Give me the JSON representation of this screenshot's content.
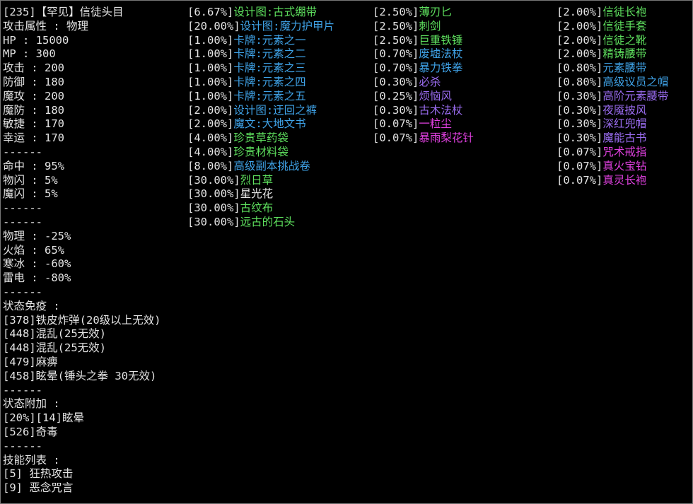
{
  "colors": {
    "white": "#e4e4e4",
    "green": "#5ee05e",
    "blue": "#3fa3e8",
    "purple": "#9a6cf0",
    "magenta": "#e040e0",
    "background": "#000000"
  },
  "monster": {
    "lines": [
      "[235]【罕见】信徒头目",
      "攻击属性 : 物理",
      "HP : 15000",
      "MP : 300",
      "攻击 : 200",
      "防御 : 180",
      "魔攻 : 200",
      "魔防 : 180",
      "敏捷 : 170",
      "幸运 : 170",
      "------",
      "命中 : 95%",
      "物闪 : 5%",
      "魔闪 : 5%",
      "------",
      "------",
      "物理 : -25%",
      "火焰 : 65%",
      "寒冰 : -60%",
      "雷电 : -80%",
      "------",
      "状态免疫 :",
      "[378]铁皮炸弹(20级以上无效)",
      "[448]混乱(25无效)",
      "[448]混乱(25无效)",
      "[479]麻痹",
      "[458]眩晕(锤头之拳 30无效)",
      "------",
      "状态附加 :",
      "[20%][14]眩晕",
      "[526]奇毒",
      "------",
      "技能列表 :",
      "[5] 狂热攻击",
      "[9] 恶念咒言"
    ]
  },
  "drops_col2": [
    {
      "pct": "[6.67%]",
      "name": "设计图:古式绷带",
      "color": "green"
    },
    {
      "pct": "[20.00%]",
      "name": "设计图:魔力护甲片",
      "color": "blue"
    },
    {
      "pct": "[1.00%]",
      "name": "卡牌:元素之一",
      "color": "blue"
    },
    {
      "pct": "[1.00%]",
      "name": "卡牌:元素之二",
      "color": "blue"
    },
    {
      "pct": "[1.00%]",
      "name": "卡牌:元素之三",
      "color": "blue"
    },
    {
      "pct": "[1.00%]",
      "name": "卡牌:元素之四",
      "color": "blue"
    },
    {
      "pct": "[1.00%]",
      "name": "卡牌:元素之五",
      "color": "blue"
    },
    {
      "pct": "[2.00%]",
      "name": "设计图:迂回之裤",
      "color": "blue"
    },
    {
      "pct": "[2.00%]",
      "name": "魔文:大地文书",
      "color": "blue"
    },
    {
      "pct": "[4.00%]",
      "name": "珍贵草药袋",
      "color": "green"
    },
    {
      "pct": "[4.00%]",
      "name": "珍贵材料袋",
      "color": "green"
    },
    {
      "pct": "[8.00%]",
      "name": "高级副本挑战卷",
      "color": "blue"
    },
    {
      "pct": "[30.00%]",
      "name": "烈日草",
      "color": "green"
    },
    {
      "pct": "[30.00%]",
      "name": "星光花",
      "color": "white"
    },
    {
      "pct": "[30.00%]",
      "name": "古纹布",
      "color": "green"
    },
    {
      "pct": "[30.00%]",
      "name": "远古的石头",
      "color": "green"
    }
  ],
  "drops_col3": [
    {
      "pct": "[2.50%]",
      "name": "薄刃匕",
      "color": "green"
    },
    {
      "pct": "[2.50%]",
      "name": "刺剑",
      "color": "green"
    },
    {
      "pct": "[2.50%]",
      "name": "巨重铁锤",
      "color": "green"
    },
    {
      "pct": "[0.70%]",
      "name": "废墟法杖",
      "color": "blue"
    },
    {
      "pct": "[0.70%]",
      "name": "暴力铁拳",
      "color": "blue"
    },
    {
      "pct": "[0.30%]",
      "name": "必杀",
      "color": "purple"
    },
    {
      "pct": "[0.25%]",
      "name": "烦恼风",
      "color": "purple"
    },
    {
      "pct": "[0.30%]",
      "name": "古木法杖",
      "color": "purple"
    },
    {
      "pct": "[0.07%]",
      "name": "一粒尘",
      "color": "magenta"
    },
    {
      "pct": "[0.07%]",
      "name": "暴雨梨花针",
      "color": "magenta"
    }
  ],
  "drops_col4": [
    {
      "pct": "[2.00%]",
      "name": "信徒长袍",
      "color": "green"
    },
    {
      "pct": "[2.00%]",
      "name": "信徒手套",
      "color": "green"
    },
    {
      "pct": "[2.00%]",
      "name": "信徒之靴",
      "color": "green"
    },
    {
      "pct": "[2.00%]",
      "name": "精铸腰带",
      "color": "green"
    },
    {
      "pct": "[0.80%]",
      "name": "元素腰带",
      "color": "blue"
    },
    {
      "pct": "[0.80%]",
      "name": "高级议员之帽",
      "color": "blue"
    },
    {
      "pct": "[0.30%]",
      "name": "高阶元素腰带",
      "color": "purple"
    },
    {
      "pct": "[0.30%]",
      "name": "夜魇披风",
      "color": "purple"
    },
    {
      "pct": "[0.30%]",
      "name": "深红兜帽",
      "color": "purple"
    },
    {
      "pct": "[0.30%]",
      "name": "魔能古书",
      "color": "purple"
    },
    {
      "pct": "[0.07%]",
      "name": "咒术戒指",
      "color": "magenta"
    },
    {
      "pct": "[0.07%]",
      "name": "真火宝钻",
      "color": "magenta"
    },
    {
      "pct": "[0.07%]",
      "name": "真灵长袍",
      "color": "magenta"
    }
  ]
}
